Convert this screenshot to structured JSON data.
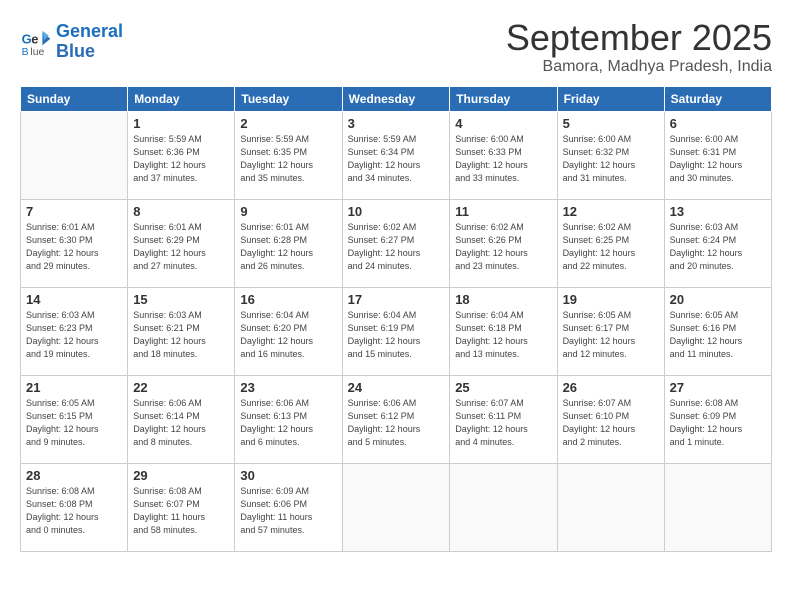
{
  "header": {
    "logo_line1": "General",
    "logo_line2": "Blue",
    "month": "September 2025",
    "location": "Bamora, Madhya Pradesh, India"
  },
  "weekdays": [
    "Sunday",
    "Monday",
    "Tuesday",
    "Wednesday",
    "Thursday",
    "Friday",
    "Saturday"
  ],
  "weeks": [
    [
      {
        "day": "",
        "info": ""
      },
      {
        "day": "1",
        "info": "Sunrise: 5:59 AM\nSunset: 6:36 PM\nDaylight: 12 hours\nand 37 minutes."
      },
      {
        "day": "2",
        "info": "Sunrise: 5:59 AM\nSunset: 6:35 PM\nDaylight: 12 hours\nand 35 minutes."
      },
      {
        "day": "3",
        "info": "Sunrise: 5:59 AM\nSunset: 6:34 PM\nDaylight: 12 hours\nand 34 minutes."
      },
      {
        "day": "4",
        "info": "Sunrise: 6:00 AM\nSunset: 6:33 PM\nDaylight: 12 hours\nand 33 minutes."
      },
      {
        "day": "5",
        "info": "Sunrise: 6:00 AM\nSunset: 6:32 PM\nDaylight: 12 hours\nand 31 minutes."
      },
      {
        "day": "6",
        "info": "Sunrise: 6:00 AM\nSunset: 6:31 PM\nDaylight: 12 hours\nand 30 minutes."
      }
    ],
    [
      {
        "day": "7",
        "info": "Sunrise: 6:01 AM\nSunset: 6:30 PM\nDaylight: 12 hours\nand 29 minutes."
      },
      {
        "day": "8",
        "info": "Sunrise: 6:01 AM\nSunset: 6:29 PM\nDaylight: 12 hours\nand 27 minutes."
      },
      {
        "day": "9",
        "info": "Sunrise: 6:01 AM\nSunset: 6:28 PM\nDaylight: 12 hours\nand 26 minutes."
      },
      {
        "day": "10",
        "info": "Sunrise: 6:02 AM\nSunset: 6:27 PM\nDaylight: 12 hours\nand 24 minutes."
      },
      {
        "day": "11",
        "info": "Sunrise: 6:02 AM\nSunset: 6:26 PM\nDaylight: 12 hours\nand 23 minutes."
      },
      {
        "day": "12",
        "info": "Sunrise: 6:02 AM\nSunset: 6:25 PM\nDaylight: 12 hours\nand 22 minutes."
      },
      {
        "day": "13",
        "info": "Sunrise: 6:03 AM\nSunset: 6:24 PM\nDaylight: 12 hours\nand 20 minutes."
      }
    ],
    [
      {
        "day": "14",
        "info": "Sunrise: 6:03 AM\nSunset: 6:23 PM\nDaylight: 12 hours\nand 19 minutes."
      },
      {
        "day": "15",
        "info": "Sunrise: 6:03 AM\nSunset: 6:21 PM\nDaylight: 12 hours\nand 18 minutes."
      },
      {
        "day": "16",
        "info": "Sunrise: 6:04 AM\nSunset: 6:20 PM\nDaylight: 12 hours\nand 16 minutes."
      },
      {
        "day": "17",
        "info": "Sunrise: 6:04 AM\nSunset: 6:19 PM\nDaylight: 12 hours\nand 15 minutes."
      },
      {
        "day": "18",
        "info": "Sunrise: 6:04 AM\nSunset: 6:18 PM\nDaylight: 12 hours\nand 13 minutes."
      },
      {
        "day": "19",
        "info": "Sunrise: 6:05 AM\nSunset: 6:17 PM\nDaylight: 12 hours\nand 12 minutes."
      },
      {
        "day": "20",
        "info": "Sunrise: 6:05 AM\nSunset: 6:16 PM\nDaylight: 12 hours\nand 11 minutes."
      }
    ],
    [
      {
        "day": "21",
        "info": "Sunrise: 6:05 AM\nSunset: 6:15 PM\nDaylight: 12 hours\nand 9 minutes."
      },
      {
        "day": "22",
        "info": "Sunrise: 6:06 AM\nSunset: 6:14 PM\nDaylight: 12 hours\nand 8 minutes."
      },
      {
        "day": "23",
        "info": "Sunrise: 6:06 AM\nSunset: 6:13 PM\nDaylight: 12 hours\nand 6 minutes."
      },
      {
        "day": "24",
        "info": "Sunrise: 6:06 AM\nSunset: 6:12 PM\nDaylight: 12 hours\nand 5 minutes."
      },
      {
        "day": "25",
        "info": "Sunrise: 6:07 AM\nSunset: 6:11 PM\nDaylight: 12 hours\nand 4 minutes."
      },
      {
        "day": "26",
        "info": "Sunrise: 6:07 AM\nSunset: 6:10 PM\nDaylight: 12 hours\nand 2 minutes."
      },
      {
        "day": "27",
        "info": "Sunrise: 6:08 AM\nSunset: 6:09 PM\nDaylight: 12 hours\nand 1 minute."
      }
    ],
    [
      {
        "day": "28",
        "info": "Sunrise: 6:08 AM\nSunset: 6:08 PM\nDaylight: 12 hours\nand 0 minutes."
      },
      {
        "day": "29",
        "info": "Sunrise: 6:08 AM\nSunset: 6:07 PM\nDaylight: 11 hours\nand 58 minutes."
      },
      {
        "day": "30",
        "info": "Sunrise: 6:09 AM\nSunset: 6:06 PM\nDaylight: 11 hours\nand 57 minutes."
      },
      {
        "day": "",
        "info": ""
      },
      {
        "day": "",
        "info": ""
      },
      {
        "day": "",
        "info": ""
      },
      {
        "day": "",
        "info": ""
      }
    ]
  ]
}
